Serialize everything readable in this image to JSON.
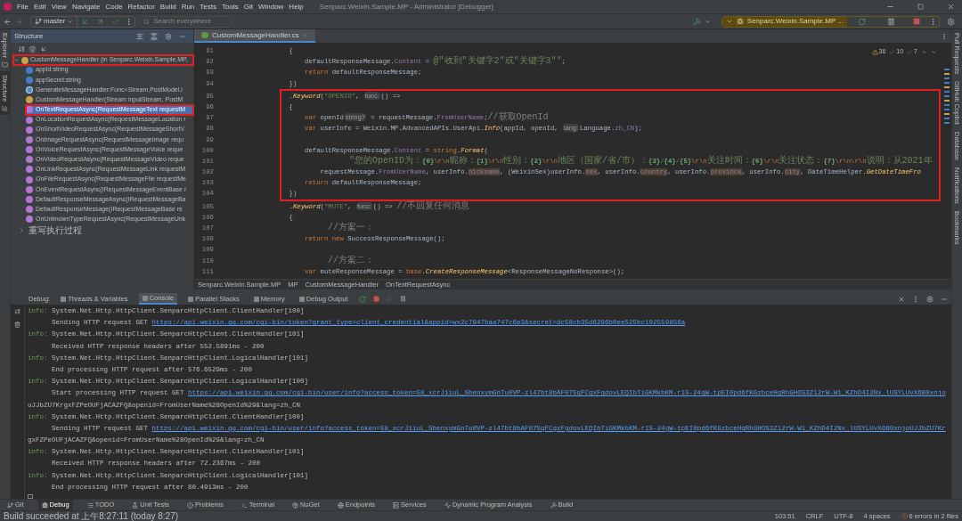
{
  "window": {
    "title": "Senparc.Weixin.Sample.MP - Administrator [Debugger]"
  },
  "menu": [
    "File",
    "Edit",
    "View",
    "Navigate",
    "Code",
    "Refactor",
    "Build",
    "Run",
    "Tests",
    "Tools",
    "Git",
    "Window",
    "Help"
  ],
  "toolbar": {
    "branch": "master",
    "search": {
      "placeholder": "Search everywhere"
    },
    "run_config": "Senparc.Weixin.Sample.MP ..."
  },
  "left_strip": [
    "Explorer",
    "Structure"
  ],
  "right_strip": [
    "Pull Requests",
    "GitHub Copilot",
    "Database",
    "Notifications",
    "Bookmarks"
  ],
  "structure": {
    "title": "Structure",
    "root": {
      "label": "CustomMessageHandler (in Senparc.Weixin.Sample.MP,",
      "expanded": true,
      "framed": true
    },
    "items": [
      {
        "kind": "field",
        "label": "appId:string",
        "selected": false,
        "framed": false
      },
      {
        "kind": "field",
        "label": "appSecret:string",
        "selected": false,
        "framed": false
      },
      {
        "kind": "property",
        "label": "GenerateMessageHandler:Func<Stream,PostModel,i",
        "selected": false,
        "framed": false
      },
      {
        "kind": "ctor",
        "label": "CustomMessageHandler(Stream inputStream, PostM",
        "selected": false,
        "framed": false
      },
      {
        "kind": "method",
        "label": "OnTextRequestAsync(RequestMessageText requestM",
        "selected": true,
        "framed": true
      },
      {
        "kind": "method",
        "label": "OnLocationRequestAsync(RequestMessageLocation r",
        "selected": false,
        "framed": false
      },
      {
        "kind": "method",
        "label": "OnShortVideoRequestAsync(RequestMessageShortV",
        "selected": false,
        "framed": false
      },
      {
        "kind": "method",
        "label": "OnImageRequestAsync(RequestMessageImage requ",
        "selected": false,
        "framed": false
      },
      {
        "kind": "method",
        "label": "OnVoiceRequestAsync(RequestMessageVoice reque",
        "selected": false,
        "framed": false
      },
      {
        "kind": "method",
        "label": "OnVideoRequestAsync(RequestMessageVideo reque",
        "selected": false,
        "framed": false
      },
      {
        "kind": "method",
        "label": "OnLinkRequestAsync(RequestMessageLink requestM",
        "selected": false,
        "framed": false
      },
      {
        "kind": "method",
        "label": "OnFileRequestAsync(RequestMessageFile requestMe",
        "selected": false,
        "framed": false
      },
      {
        "kind": "method",
        "label": "OnEventRequestAsync(IRequestMessageEventBase r",
        "selected": false,
        "framed": false
      },
      {
        "kind": "method",
        "label": "DefaultResponseMessageAsync(IRequestMessageBa",
        "selected": false,
        "framed": false
      },
      {
        "kind": "method",
        "label": "DefaultResponseMessage(IRequestMessageBase re",
        "selected": false,
        "framed": false
      },
      {
        "kind": "method",
        "label": "OnUnknownTypeRequestAsync(RequestMessageUnk",
        "selected": false,
        "framed": false
      }
    ],
    "region": {
      "label": "重写执行过程",
      "expanded": false
    }
  },
  "editor": {
    "tab": "CustomMessageHandler.cs",
    "inspections": {
      "warnings": "36",
      "weak": "10",
      "typos": "7"
    },
    "blocks": [
      {
        "framed": false,
        "lines": [
          {
            "no": "91",
            "tokens": [
              {
                "kind": "plain",
                "text": "            {"
              }
            ]
          },
          {
            "no": "92",
            "tokens": [
              {
                "kind": "plain",
                "text": "                defaultResponseMessage."
              },
              {
                "kind": "field",
                "text": "Content"
              },
              {
                "kind": "plain",
                "text": " = "
              },
              {
                "kind": "string",
                "text": "@\"收到\"关键字2\"或\"关键字3\"\""
              },
              {
                "kind": "plain",
                "text": ";"
              }
            ]
          },
          {
            "no": "93",
            "tokens": [
              {
                "kind": "keyword",
                "text": "                return "
              },
              {
                "kind": "plain",
                "text": "defaultResponseMessage;"
              }
            ]
          },
          {
            "no": "94",
            "tokens": [
              {
                "kind": "plain",
                "text": "            })"
              }
            ]
          }
        ]
      },
      {
        "framed": true,
        "lines": [
          {
            "no": "95",
            "tokens": [
              {
                "kind": "plain",
                "text": "            ."
              },
              {
                "kind": "method",
                "text": "Keyword"
              },
              {
                "kind": "plain",
                "text": "("
              },
              {
                "kind": "string",
                "text": "\"OPENID\""
              },
              {
                "kind": "plain",
                "text": ", "
              },
              {
                "kind": "hint",
                "text": "func:"
              },
              {
                "kind": "plain",
                "text": "() =>"
              }
            ]
          },
          {
            "no": "96",
            "tokens": [
              {
                "kind": "plain",
                "text": "            {"
              }
            ]
          },
          {
            "no": "97",
            "tokens": [
              {
                "kind": "keyword",
                "text": "                var "
              },
              {
                "kind": "plain",
                "text": "openId"
              },
              {
                "kind": "hint",
                "text": "string?"
              },
              {
                "kind": "plain",
                "text": " = requestMessage."
              },
              {
                "kind": "field",
                "text": "FromUserName"
              },
              {
                "kind": "plain",
                "text": ";"
              },
              {
                "kind": "comment",
                "text": "//获取OpenId"
              }
            ]
          },
          {
            "no": "98",
            "tokens": [
              {
                "kind": "keyword",
                "text": "                var "
              },
              {
                "kind": "plain",
                "text": "userInfo = Weixin.MP.AdvancedAPIs.UserApi."
              },
              {
                "kind": "method",
                "text": "Info"
              },
              {
                "kind": "plain",
                "text": "(appId, openId, "
              },
              {
                "kind": "hint",
                "text": "lang:"
              },
              {
                "kind": "plain",
                "text": "Language."
              },
              {
                "kind": "field",
                "text": "zh_CN"
              },
              {
                "kind": "plain",
                "text": ");"
              }
            ]
          },
          {
            "no": "99"
          },
          {
            "no": "100",
            "tokens": [
              {
                "kind": "plain",
                "text": "                defaultResponseMessage."
              },
              {
                "kind": "field",
                "text": "Content"
              },
              {
                "kind": "plain",
                "text": " = "
              },
              {
                "kind": "keyword",
                "text": "string"
              },
              {
                "kind": "plain",
                "text": "."
              },
              {
                "kind": "method",
                "text": "Format"
              },
              {
                "kind": "plain",
                "text": "("
              }
            ]
          },
          {
            "no": "101",
            "tokens": [
              {
                "kind": "string",
                "text": "                    \"您的OpenID为："
              },
              {
                "kind": "placeholder",
                "text": "{0}"
              },
              {
                "kind": "escape",
                "text": "\\r\\n"
              },
              {
                "kind": "string",
                "text": "昵称："
              },
              {
                "kind": "placeholder",
                "text": "{1}"
              },
              {
                "kind": "escape",
                "text": "\\r\\n"
              },
              {
                "kind": "string",
                "text": "性别："
              },
              {
                "kind": "placeholder",
                "text": "{2}"
              },
              {
                "kind": "escape",
                "text": "\\r\\n"
              },
              {
                "kind": "string",
                "text": "地区（国家/省/市）："
              },
              {
                "kind": "placeholder",
                "text": "{3}"
              },
              {
                "kind": "string",
                "text": "/"
              },
              {
                "kind": "placeholder",
                "text": "{4}"
              },
              {
                "kind": "string",
                "text": "/"
              },
              {
                "kind": "placeholder",
                "text": "{5}"
              },
              {
                "kind": "escape",
                "text": "\\r\\n"
              },
              {
                "kind": "string",
                "text": "关注时间："
              },
              {
                "kind": "placeholder",
                "text": "{6}"
              },
              {
                "kind": "escape",
                "text": "\\r\\n"
              },
              {
                "kind": "string",
                "text": "关注状态："
              },
              {
                "kind": "placeholder",
                "text": "{7}"
              },
              {
                "kind": "escape",
                "text": "\\r\\n\\r\\n"
              },
              {
                "kind": "string",
                "text": "说明：从2021年"
              }
            ]
          },
          {
            "no": "102",
            "tokens": [
              {
                "kind": "plain",
                "text": "                    requestMessage."
              },
              {
                "kind": "field",
                "text": "FromUserName"
              },
              {
                "kind": "plain",
                "text": ", userInfo."
              },
              {
                "kind": "field_hl",
                "text": "nickname"
              },
              {
                "kind": "plain",
                "text": ", (WeixinSex)userInfo."
              },
              {
                "kind": "field_hl",
                "text": "sex"
              },
              {
                "kind": "plain",
                "text": ", userInfo."
              },
              {
                "kind": "field_hl",
                "text": "country"
              },
              {
                "kind": "plain",
                "text": ", userInfo."
              },
              {
                "kind": "field_hl",
                "text": "province"
              },
              {
                "kind": "plain",
                "text": ", userInfo."
              },
              {
                "kind": "field_hl",
                "text": "city"
              },
              {
                "kind": "plain",
                "text": ", DateTimeHelper."
              },
              {
                "kind": "method",
                "text": "GetDateTimeFro"
              }
            ]
          },
          {
            "no": "103",
            "tokens": [
              {
                "kind": "keyword",
                "text": "                return "
              },
              {
                "kind": "plain",
                "text": "defaultResponseMessage;"
              }
            ]
          },
          {
            "no": "104",
            "tokens": [
              {
                "kind": "plain",
                "text": "            })"
              }
            ]
          }
        ]
      },
      {
        "framed": false,
        "lines": [
          {
            "no": "105",
            "tokens": [
              {
                "kind": "plain",
                "text": "            ."
              },
              {
                "kind": "method",
                "text": "Keyword"
              },
              {
                "kind": "plain",
                "text": "("
              },
              {
                "kind": "string",
                "text": "\"MUTE\""
              },
              {
                "kind": "plain",
                "text": ", "
              },
              {
                "kind": "hint",
                "text": "func:"
              },
              {
                "kind": "plain",
                "text": "() => "
              },
              {
                "kind": "comment",
                "text": "//不回复任何消息"
              }
            ]
          },
          {
            "no": "106",
            "tokens": [
              {
                "kind": "plain",
                "text": "            {"
              }
            ]
          },
          {
            "no": "107",
            "tokens": [
              {
                "kind": "comment",
                "text": "                //方案一："
              }
            ]
          },
          {
            "no": "108",
            "tokens": [
              {
                "kind": "keyword",
                "text": "                return new "
              },
              {
                "kind": "plain",
                "text": "SuccessResponseMessage();"
              }
            ]
          },
          {
            "no": "109"
          },
          {
            "no": "110",
            "tokens": [
              {
                "kind": "comment",
                "text": "                //方案二："
              }
            ]
          },
          {
            "no": "111",
            "tokens": [
              {
                "kind": "keyword",
                "text": "                var "
              },
              {
                "kind": "plain",
                "text": "muteResponseMessage = "
              },
              {
                "kind": "keyword",
                "text": "base"
              },
              {
                "kind": "plain",
                "text": "."
              },
              {
                "kind": "method",
                "text": "CreateResponseMessage"
              },
              {
                "kind": "plain",
                "text": "<ResponseMessageNoResponse>();"
              }
            ]
          }
        ]
      }
    ]
  },
  "breadcrumb": [
    "Senparc.Weixin.Sample.MP",
    "MP",
    "CustomMessageHandler",
    "OnTextRequestAsync"
  ],
  "debug": {
    "label": "Debug:",
    "tabs": [
      {
        "label": "Threads & Variables",
        "selected": false
      },
      {
        "label": "Console",
        "selected": true
      },
      {
        "label": "Parallel Stacks",
        "selected": false
      },
      {
        "label": "Memory",
        "selected": false
      },
      {
        "label": "Debug Output",
        "selected": false
      }
    ],
    "console": [
      {
        "kind": "info",
        "prefix": "info:",
        "text": "System.Net.Http.HttpClient.SenparcHttpClient.ClientHandler[100]"
      },
      {
        "kind": "detail",
        "text": "      Sending HTTP request GET ",
        "link": "https://api.weixin.qq.com/cgi-bin/token?grant_type=client_credential&appid=wx2c7947baa747c6e3&secret=dc58cb35d6296b0ee525bc102559856a"
      },
      {
        "kind": "info",
        "prefix": "info:",
        "text": "System.Net.Http.HttpClient.SenparcHttpClient.ClientHandler[101]"
      },
      {
        "kind": "detail",
        "text": "      Received HTTP response headers after 552.5891ms - 200"
      },
      {
        "kind": "info",
        "prefix": "info:",
        "text": "System.Net.Http.HttpClient.SenparcHttpClient.LogicalHandler[101]"
      },
      {
        "kind": "detail",
        "text": "      End processing HTTP request after 576.6529ms - 200"
      },
      {
        "kind": "info",
        "prefix": "info:",
        "text": "System.Net.Http.HttpClient.SenparcHttpClient.LogicalHandler[100]"
      },
      {
        "kind": "detail",
        "text": "      Start processing HTTP request GET ",
        "link": "https://api.weixin.qq.com/cgi-bin/user/info?access_token=58_xcrJiiuL_SbenxymGnTu0VP-zl47bt8bAF075qFCgxFgdovLEQIbTiGKMkbKM-r1S-24gW-tpEI0pd6fKGzbceHgRhGHOS3Z12rW-W1_KZhD4I2Nx_lUSYLUvX6B0xnjo"
      },
      {
        "kind": "detail",
        "text": "uJJbZU7KrgxFZPeOUFjACAZFQ&openid=FromUserName%28OpenId%29&lang=zh_CN"
      },
      {
        "kind": "info",
        "prefix": "info:",
        "text": "System.Net.Http.HttpClient.SenparcHttpClient.ClientHandler[100]"
      },
      {
        "kind": "detail",
        "text": "      Sending HTTP request GET ",
        "link": "https://api.weixin.qq.com/cgi-bin/user/info?access_token=58_xcrJiiuL_SbenxymGnTu0VP-zl47bt8bAF075qFCgxFgdovLEQIbTiGKMkbKM-r1S-24gW-tpEI0pd6fKGzbceHgRhGHOS3Z12rW-W1_KZhD4I2Nx_lUSYLUvX6B0xnjoUJJbZU7Kr"
      },
      {
        "kind": "detail",
        "text": "gxFZPeOUFjACAZFQ&openid=FromUserName%28OpenId%29&lang=zh_CN"
      },
      {
        "kind": "info",
        "prefix": "info:",
        "text": "System.Net.Http.HttpClient.SenparcHttpClient.ClientHandler[101]"
      },
      {
        "kind": "detail",
        "text": "      Received HTTP response headers after 72.2367ms - 200"
      },
      {
        "kind": "info",
        "prefix": "info:",
        "text": "System.Net.Http.HttpClient.SenparcHttpClient.LogicalHandler[101]"
      },
      {
        "kind": "detail",
        "text": "      End processing HTTP request after 80.4913ms - 200"
      }
    ]
  },
  "tool_windows": [
    {
      "label": "Git",
      "selected": false
    },
    {
      "label": "Debug",
      "selected": true
    },
    {
      "label": "TODO",
      "selected": false
    },
    {
      "label": "Unit Tests",
      "selected": false
    },
    {
      "label": "Problems",
      "selected": false
    },
    {
      "label": "Terminal",
      "selected": false
    },
    {
      "label": "NuGet",
      "selected": false
    },
    {
      "label": "Endpoints",
      "selected": false
    },
    {
      "label": "Services",
      "selected": false
    },
    {
      "label": "Dynamic Program Analysis",
      "selected": false
    },
    {
      "label": "Build",
      "selected": false
    }
  ],
  "status_bar": {
    "message": "Build succeeded at 上午8:27:11 (today 8:27)",
    "position": "103:51",
    "line_sep": "CRLF",
    "encoding": "UTF-8",
    "indent": "4 spaces",
    "errors": "6 errors in 2 files"
  }
}
